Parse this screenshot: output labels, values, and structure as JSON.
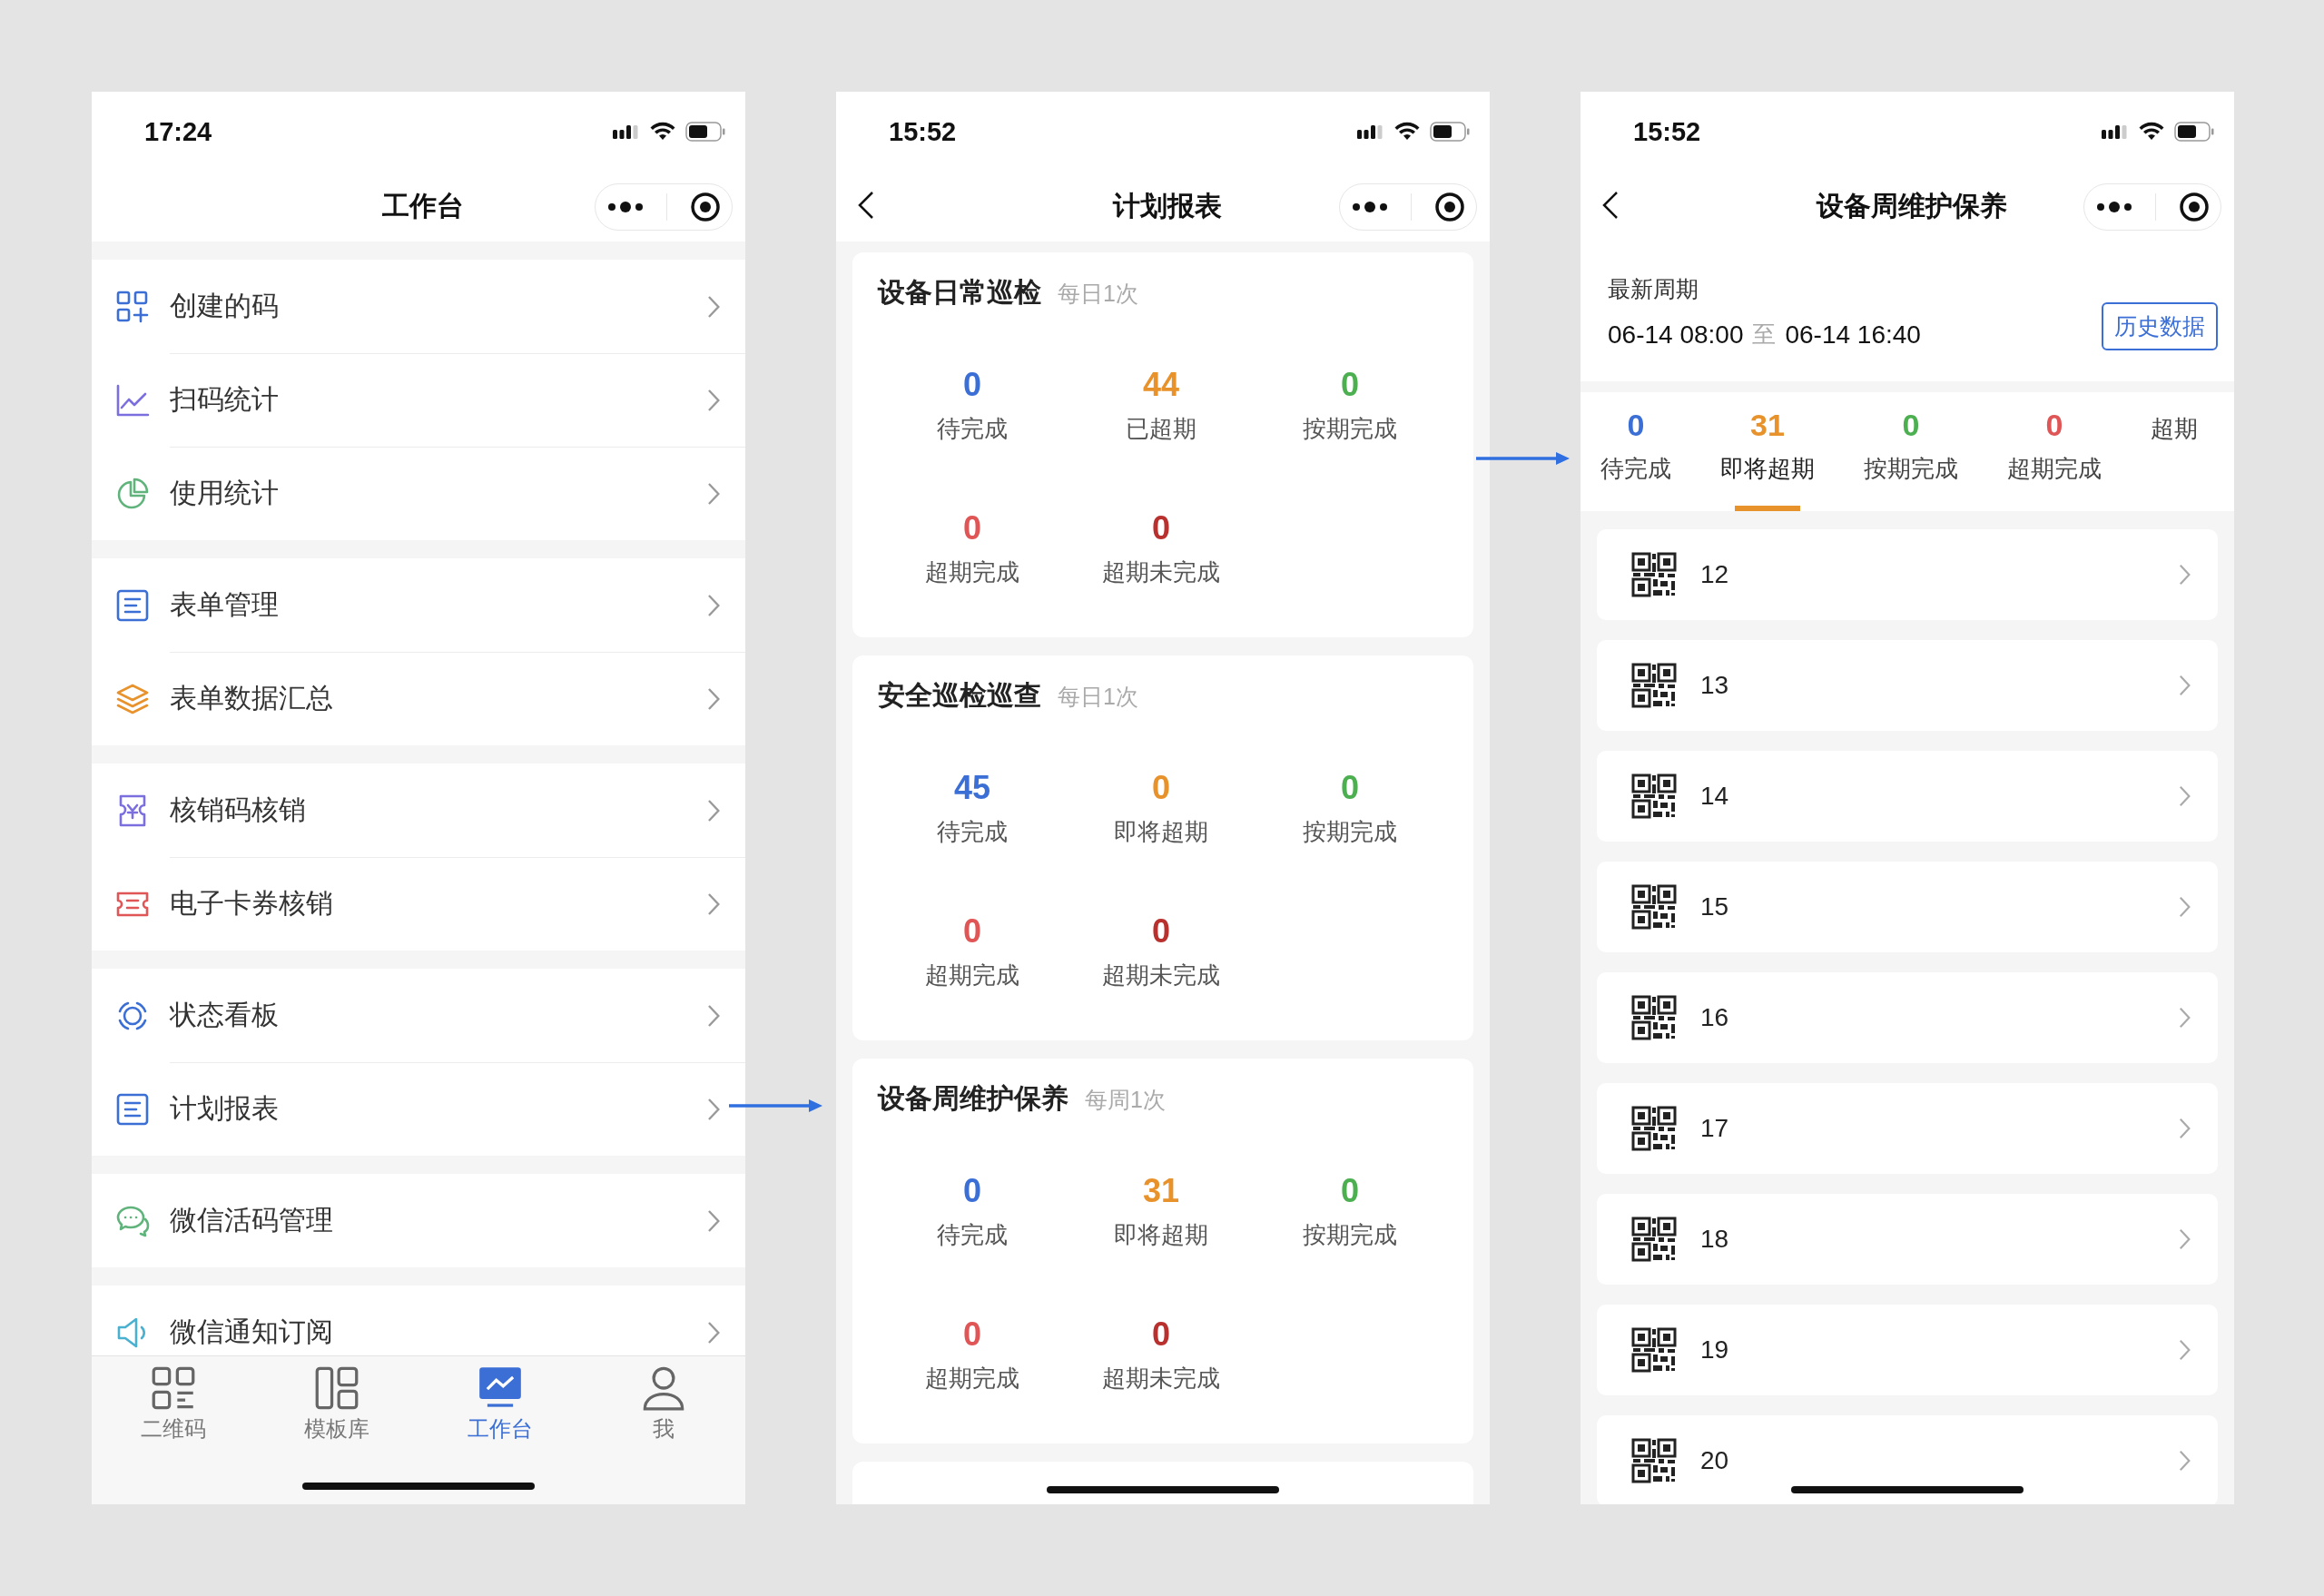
{
  "workbench_screen": {
    "status_time": "17:24",
    "title": "工作台",
    "groups": [
      {
        "items": [
          {
            "label": "创建的码"
          },
          {
            "label": "扫码统计"
          },
          {
            "label": "使用统计"
          }
        ]
      },
      {
        "items": [
          {
            "label": "表单管理"
          },
          {
            "label": "表单数据汇总"
          }
        ]
      },
      {
        "items": [
          {
            "label": "核销码核销"
          },
          {
            "label": "电子卡券核销"
          }
        ]
      },
      {
        "items": [
          {
            "label": "状态看板"
          },
          {
            "label": "计划报表"
          }
        ]
      },
      {
        "items": [
          {
            "label": "微信活码管理"
          }
        ]
      },
      {
        "items": [
          {
            "label": "微信通知订阅"
          }
        ]
      }
    ],
    "tab_bar": [
      {
        "label": "二维码",
        "selected": false
      },
      {
        "label": "模板库",
        "selected": false
      },
      {
        "label": "工作台",
        "selected": true
      },
      {
        "label": "我",
        "selected": false
      }
    ]
  },
  "plan_report_screen": {
    "status_time": "15:52",
    "title": "计划报表",
    "cards": [
      {
        "title": "设备日常巡检",
        "frequency": "每日1次",
        "stats": [
          {
            "value": "0",
            "label": "待完成",
            "color": "#3b6fd6"
          },
          {
            "value": "44",
            "label": "已超期",
            "color": "#e8922c"
          },
          {
            "value": "0",
            "label": "按期完成",
            "color": "#4caf50"
          },
          {
            "value": "0",
            "label": "超期完成",
            "color": "#e05555"
          },
          {
            "value": "0",
            "label": "超期未完成",
            "color": "#b8312f"
          }
        ]
      },
      {
        "title": "安全巡检巡查",
        "frequency": "每日1次",
        "stats": [
          {
            "value": "45",
            "label": "待完成",
            "color": "#3b6fd6"
          },
          {
            "value": "0",
            "label": "即将超期",
            "color": "#e8922c"
          },
          {
            "value": "0",
            "label": "按期完成",
            "color": "#4caf50"
          },
          {
            "value": "0",
            "label": "超期完成",
            "color": "#e05555"
          },
          {
            "value": "0",
            "label": "超期未完成",
            "color": "#b8312f"
          }
        ]
      },
      {
        "title": "设备周维护保养",
        "frequency": "每周1次",
        "stats": [
          {
            "value": "0",
            "label": "待完成",
            "color": "#3b6fd6"
          },
          {
            "value": "31",
            "label": "即将超期",
            "color": "#e8922c"
          },
          {
            "value": "0",
            "label": "按期完成",
            "color": "#4caf50"
          },
          {
            "value": "0",
            "label": "超期完成",
            "color": "#e05555"
          },
          {
            "value": "0",
            "label": "超期未完成",
            "color": "#b8312f"
          }
        ]
      }
    ]
  },
  "maintenance_screen": {
    "status_time": "15:52",
    "title": "设备周维护保养",
    "period_label": "最新周期",
    "period_start": "06-14 08:00",
    "period_separator": "至",
    "period_end": "06-14 16:40",
    "history_button": "历史数据",
    "tabs": [
      {
        "value": "0",
        "label": "待完成",
        "color": "#3b6fd6",
        "selected": false
      },
      {
        "value": "31",
        "label": "即将超期",
        "color": "#e8922c",
        "selected": true
      },
      {
        "value": "0",
        "label": "按期完成",
        "color": "#4caf50",
        "selected": false
      },
      {
        "value": "0",
        "label": "超期完成",
        "color": "#e05555",
        "selected": false
      },
      {
        "label": "超期",
        "selected": false
      }
    ],
    "items": [
      "12",
      "13",
      "14",
      "15",
      "16",
      "17",
      "18",
      "19",
      "20"
    ]
  }
}
